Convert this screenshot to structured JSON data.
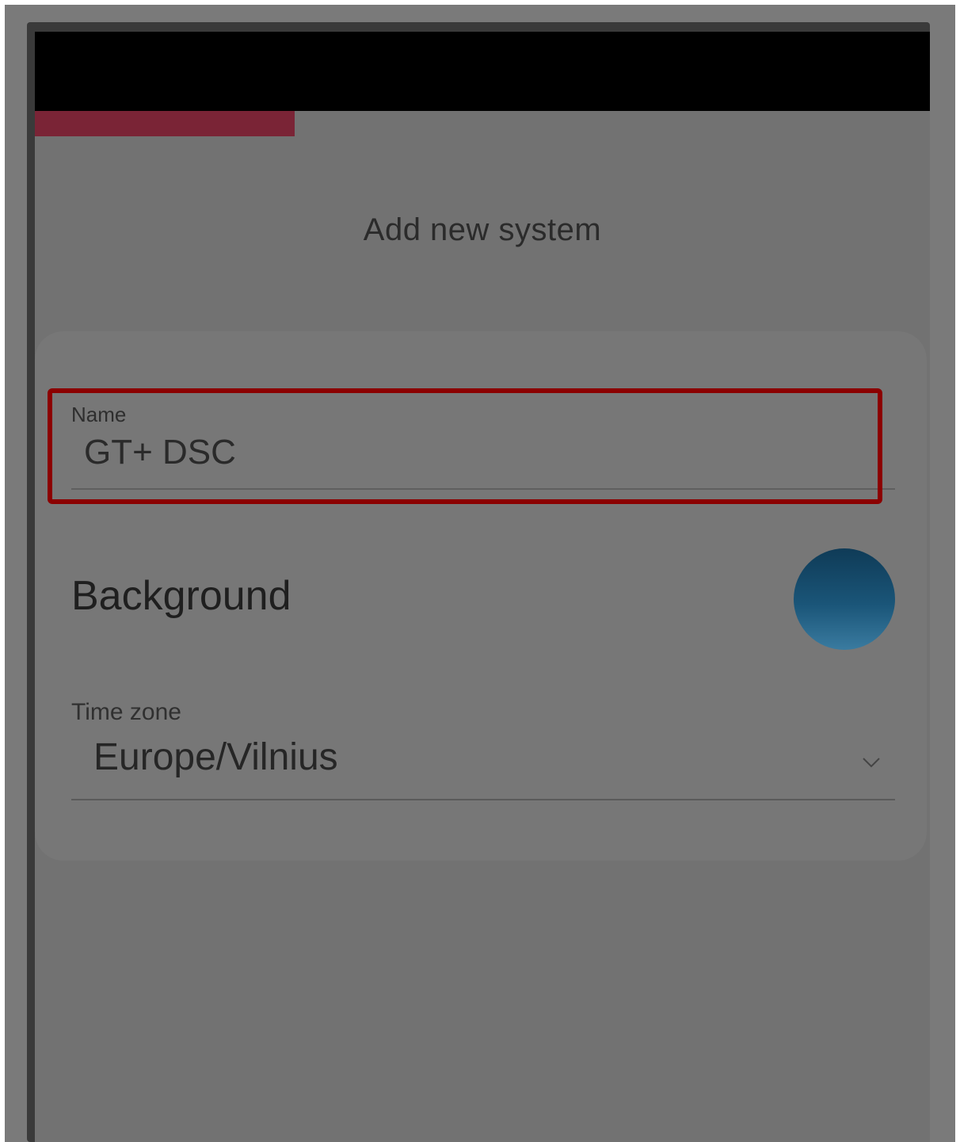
{
  "colors": {
    "accent": "#7a2436",
    "highlight_border": "#8b0000",
    "overlay": "#727272",
    "swatch": "#1a5578"
  },
  "progress": {
    "fraction": 0.29
  },
  "header": {
    "title": "Add new system"
  },
  "form": {
    "name": {
      "label": "Name",
      "value": "GT+ DSC"
    },
    "background": {
      "label": "Background"
    },
    "time_zone": {
      "label": "Time zone",
      "value": "Europe/Vilnius",
      "icon": "chevron-down-icon"
    }
  }
}
